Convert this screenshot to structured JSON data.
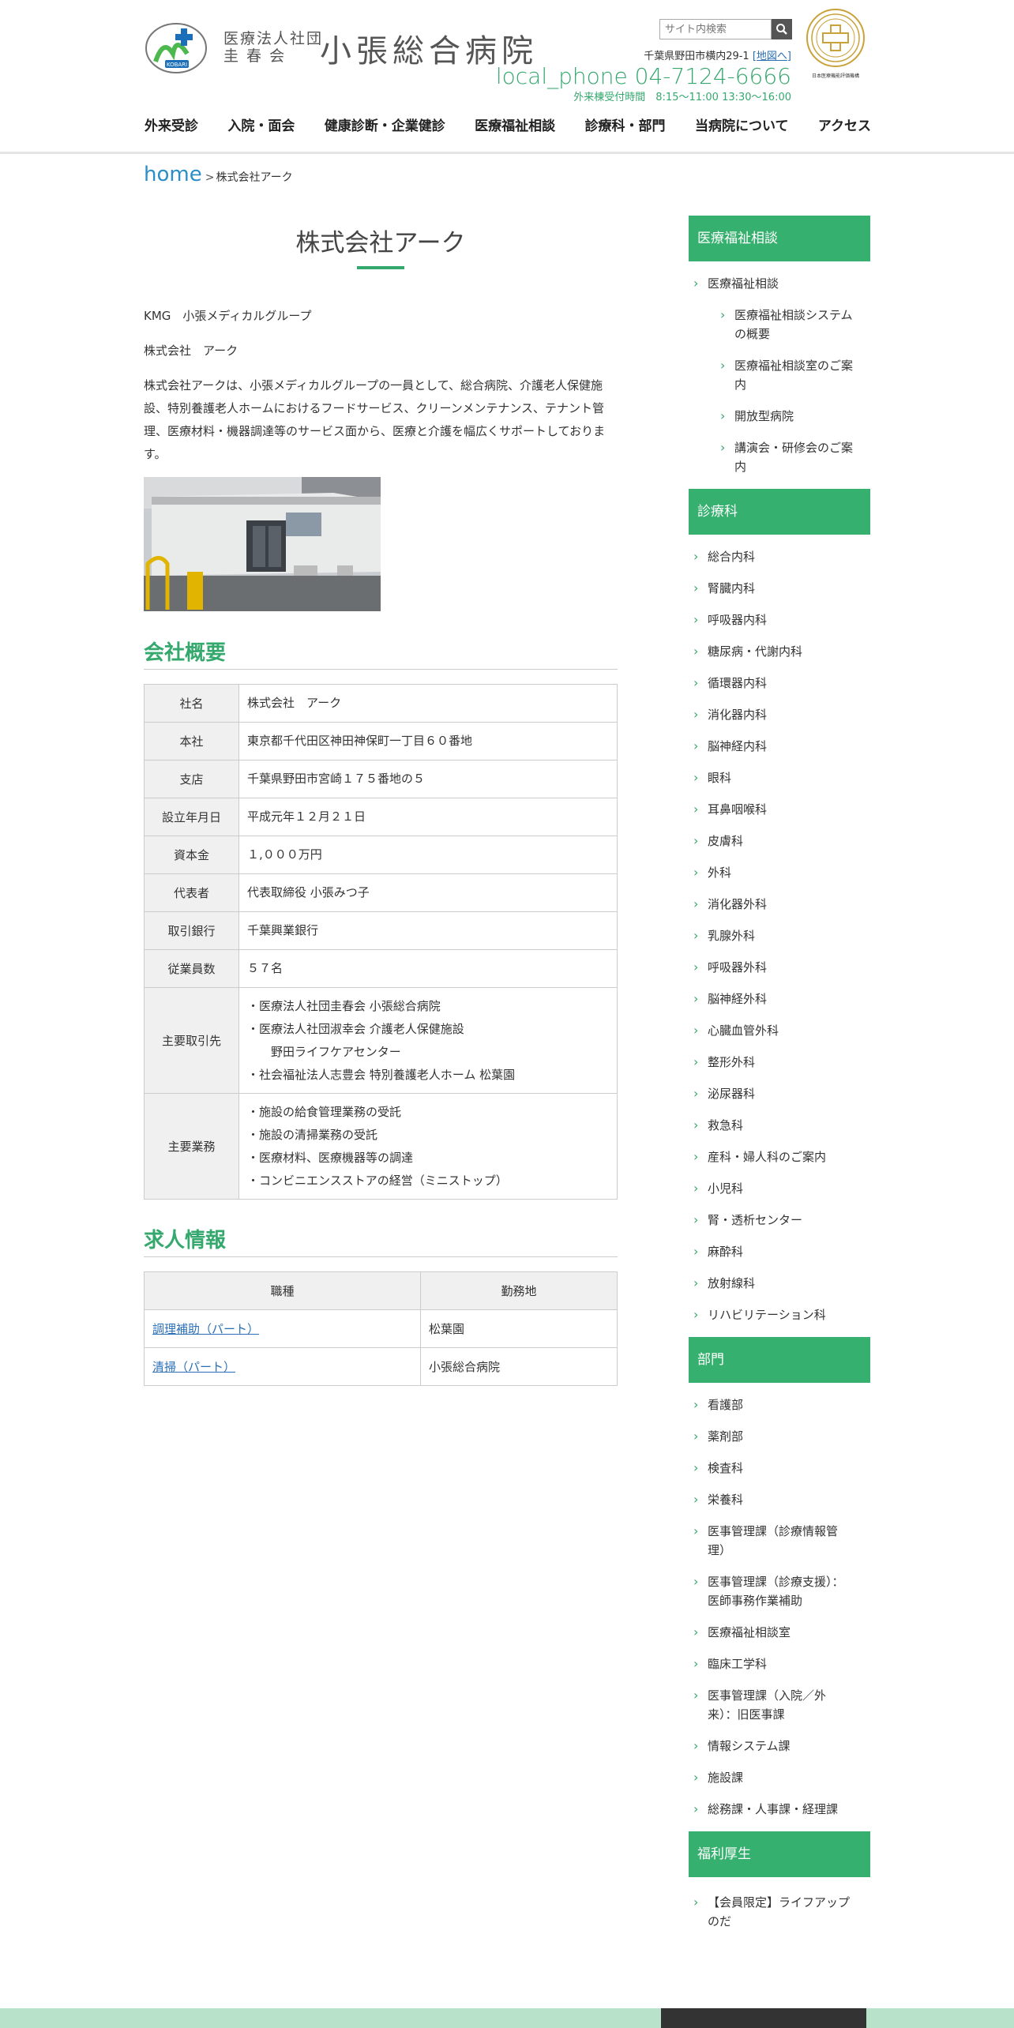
{
  "header": {
    "org_name_line1": "医療法人社団",
    "org_name_line2": "圭 春 会",
    "hospital_name": "小張総合病院",
    "logo_text": "KOBARI",
    "search_placeholder": "サイト内検索",
    "address": "千葉県野田市横内29-1",
    "map_link": "[地図へ]",
    "phone": "local_phone 04-7124-6666",
    "hours": "外来棟受付時間　8:15～11:00 13:30～16:00",
    "badge_text": "日本医療機能評価機構"
  },
  "gnav": [
    "外来受診",
    "入院・面会",
    "健康診断・企業健診",
    "医療福祉相談",
    "診療科・部門",
    "当病院について",
    "アクセス"
  ],
  "breadcrumb": {
    "home": "home",
    "separator": ">",
    "current": "株式会社アーク"
  },
  "main": {
    "title": "株式会社アーク",
    "intro1": "KMG　小張メディカルグループ",
    "intro2": "株式会社　アーク",
    "intro3": "株式会社アークは、小張メディカルグループの一員として、総合病院、介護老人保健施設、特別養護老人ホームにおけるフードサービス、クリーンメンテナンス、テナント管理、医療材料・機器調達等のサービス面から、医療と介護を幅広くサポートしております。",
    "overview_title": "会社概要",
    "overview": [
      {
        "label": "社名",
        "value": "株式会社　アーク"
      },
      {
        "label": "本社",
        "value": "東京都千代田区神田神保町一丁目６０番地"
      },
      {
        "label": "支店",
        "value": "千葉県野田市宮崎１７５番地の５"
      },
      {
        "label": "設立年月日",
        "value": "平成元年１２月２１日"
      },
      {
        "label": "資本金",
        "value": "１,０００万円"
      },
      {
        "label": "代表者",
        "value": "代表取締役 小張みつ子"
      },
      {
        "label": "取引銀行",
        "value": "千葉興業銀行"
      },
      {
        "label": "従業員数",
        "value": "５７名"
      }
    ],
    "clients_label": "主要取引先",
    "clients": [
      "・医療法人社団圭春会 小張総合病院",
      "・医療法人社団淑幸会 介護老人保健施設",
      "　　野田ライフケアセンター",
      "・社会福祉法人志豊会 特別養護老人ホーム 松葉園"
    ],
    "business_label": "主要業務",
    "business": [
      "・施設の給食管理業務の受託",
      "・施設の清掃業務の受託",
      "・医療材料、医療機器等の調達",
      "・コンビニエンスストアの経営（ミニストップ）"
    ],
    "jobs_title": "求人情報",
    "jobs_headers": [
      "職種",
      "勤務地"
    ],
    "jobs": [
      {
        "title": "調理補助（パート）",
        "location": "松葉園"
      },
      {
        "title": "清掃（パート）",
        "location": "小張総合病院"
      }
    ]
  },
  "sidebar": {
    "welfare_head": "医療福祉相談",
    "welfare_main": "医療福祉相談",
    "welfare_subs": [
      [
        "医療福祉相談システム",
        "の概要"
      ],
      [
        "医療福祉相談室のご案",
        "内"
      ],
      [
        "開放型病院"
      ],
      [
        "講演会・研修会のご案",
        "内"
      ]
    ],
    "dept_head": "診療科",
    "depts": [
      "総合内科",
      "腎臓内科",
      "呼吸器内科",
      "糖尿病・代謝内科",
      "循環器内科",
      "消化器内科",
      "脳神経内科",
      "眼科",
      "耳鼻咽喉科",
      "皮膚科",
      "外科",
      "消化器外科",
      "乳腺外科",
      "呼吸器外科",
      "脳神経外科",
      "心臓血管外科",
      "整形外科",
      "泌尿器科",
      "救急科",
      "産科・婦人科のご案内",
      "小児科",
      "腎・透析センター",
      "麻酔科",
      "放射線科",
      "リハビリテーション科"
    ],
    "section_head": "部門",
    "sections": [
      [
        "看護部"
      ],
      [
        "薬剤部"
      ],
      [
        "検査科"
      ],
      [
        "栄養科"
      ],
      [
        "医事管理課（診療情報管",
        "理）"
      ],
      [
        "医事管理課（診療支援）：",
        "医師事務作業補助"
      ],
      [
        "医療福祉相談室"
      ],
      [
        "臨床工学科"
      ],
      [
        "医事管理課（入院／外",
        "来）：旧医事課"
      ],
      [
        "情報システム課"
      ],
      [
        "施設課"
      ],
      [
        "総務課・人事課・経理課"
      ]
    ],
    "benefit_head": "福利厚生",
    "benefits": [
      [
        "【会員限定】ライフアップ",
        "のだ"
      ]
    ]
  }
}
